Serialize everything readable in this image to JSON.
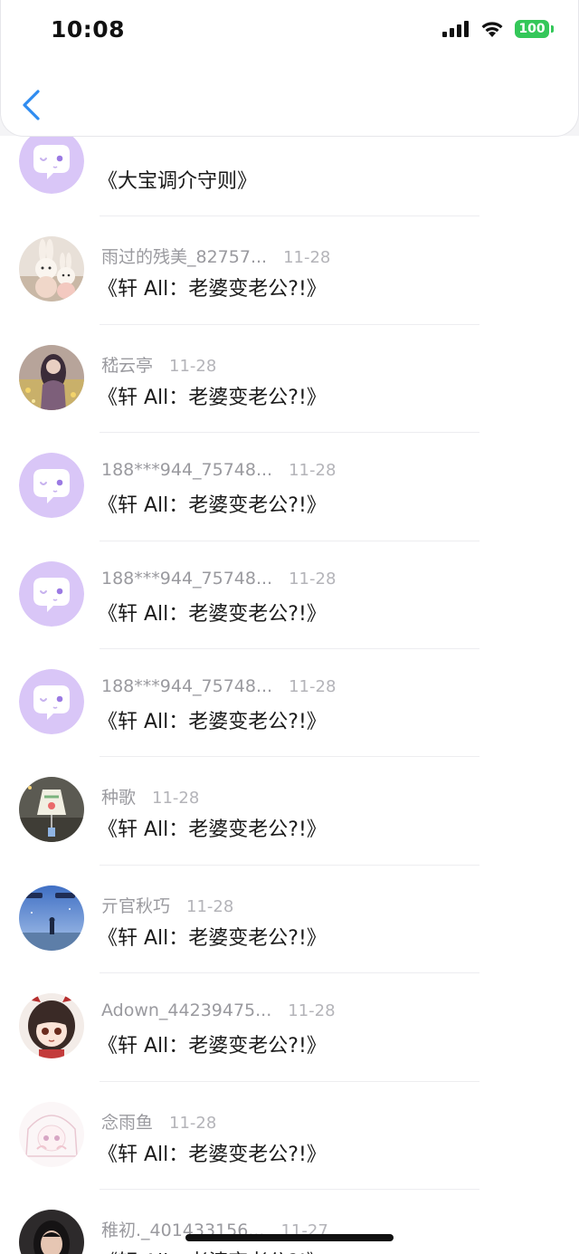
{
  "status_bar": {
    "time": "10:08",
    "battery": "100"
  },
  "colors": {
    "accent": "#2f8cf0",
    "battery": "#34c759",
    "default_avatar": "#d9c6f7"
  },
  "messages": [
    {
      "name": "",
      "date": "",
      "title": "《大宝调介守则》",
      "avatar": "default-avatar"
    },
    {
      "name": "雨过的残美_82757...",
      "date": "11-28",
      "title": "《轩 All：老婆变老公?!》",
      "avatar": "bunny-plush-avatar"
    },
    {
      "name": "嵇云亭",
      "date": "11-28",
      "title": "《轩 All：老婆变老公?!》",
      "avatar": "girl-in-flowers-avatar"
    },
    {
      "name": "188***944_75748...",
      "date": "11-28",
      "title": "《轩 All：老婆变老公?!》",
      "avatar": "default-avatar"
    },
    {
      "name": "188***944_75748...",
      "date": "11-28",
      "title": "《轩 All：老婆变老公?!》",
      "avatar": "default-avatar"
    },
    {
      "name": "188***944_75748...",
      "date": "11-28",
      "title": "《轩 All：老婆变老公?!》",
      "avatar": "default-avatar"
    },
    {
      "name": "种歌",
      "date": "11-28",
      "title": "《轩 All：老婆变老公?!》",
      "avatar": "wind-chime-avatar"
    },
    {
      "name": "亓官秋巧",
      "date": "11-28",
      "title": "《轩 All：老婆变老公?!》",
      "avatar": "night-sky-avatar"
    },
    {
      "name": "Adown_44239475...",
      "date": "11-28",
      "title": "《轩 All：老婆变老公?!》",
      "avatar": "anime-girl-avatar"
    },
    {
      "name": "念雨鱼",
      "date": "11-28",
      "title": "《轩 All：老婆变老公?!》",
      "avatar": "sketch-girl-avatar"
    },
    {
      "name": "稚初._401433156...",
      "date": "11-27",
      "title": "《轩 All：老婆变老公?!》",
      "avatar": "portrait-avatar"
    }
  ]
}
